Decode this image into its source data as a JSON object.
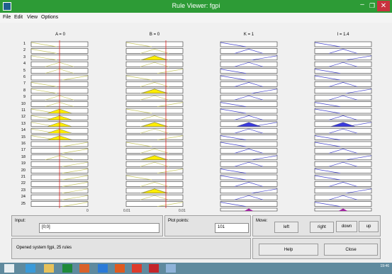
{
  "window": {
    "title": "Rule Viewer: fgpi",
    "minimize_glyph": "–",
    "maximize_glyph": "❐",
    "close_glyph": "✕"
  },
  "menu": [
    "File",
    "Edit",
    "View",
    "Options"
  ],
  "columns": [
    {
      "label": "A = 0",
      "kind": "input",
      "color": "#c8c864"
    },
    {
      "label": "B = 0",
      "kind": "input",
      "color": "#c8c864"
    },
    {
      "label": "K = 1",
      "kind": "output",
      "color": "#4444cc"
    },
    {
      "label": "I = 1.4",
      "kind": "output",
      "color": "#4444cc"
    }
  ],
  "rule_numbers": [
    "1",
    "2",
    "3",
    "4",
    "5",
    "6",
    "7",
    "8",
    "9",
    "10",
    "11",
    "12",
    "13",
    "14",
    "15",
    "16",
    "17",
    "18",
    "19",
    "20",
    "21",
    "22",
    "23",
    "24",
    "25"
  ],
  "axis_labels": {
    "col1_min": "0",
    "col2_min": "0.01",
    "col2_max": "0.01"
  },
  "controls": {
    "input_label": "Input:",
    "input_value": "[0;0]",
    "plot_points_label": "Plot points:",
    "plot_points_value": "101",
    "move_label": "Move:",
    "move_buttons": [
      "left",
      "right",
      "down",
      "up"
    ],
    "status_text": "Opened system fgpi, 25 rules",
    "help_label": "Help",
    "close_label": "Close"
  },
  "colors": {
    "titlebar": "#2d9b36",
    "red_line": "#e02020",
    "input_fill": "#ffee00",
    "output_fill": "#3b3bdd"
  },
  "taskbar": {
    "clock": "19:46"
  }
}
